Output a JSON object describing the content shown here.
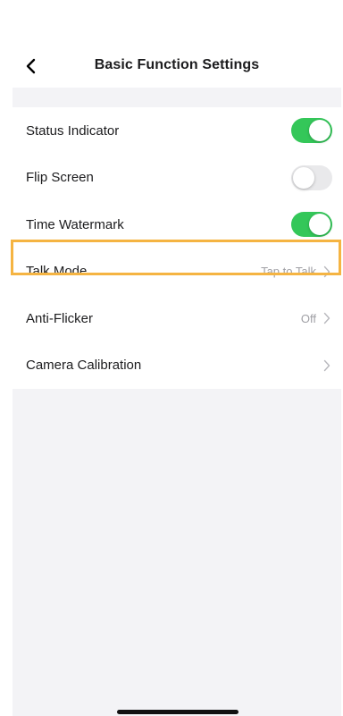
{
  "header": {
    "title": "Basic Function Settings",
    "back_icon": "chevron-left-icon"
  },
  "settings": [
    {
      "label": "Status Indicator",
      "type": "toggle",
      "on": true
    },
    {
      "label": "Flip Screen",
      "type": "toggle",
      "on": false
    },
    {
      "label": "Time Watermark",
      "type": "toggle",
      "on": true
    },
    {
      "label": "Talk Mode",
      "type": "nav",
      "value": "Tap to Talk",
      "highlighted": true
    },
    {
      "label": "Anti-Flicker",
      "type": "nav",
      "value": "Off"
    },
    {
      "label": "Camera Calibration",
      "type": "nav",
      "value": ""
    }
  ],
  "colors": {
    "toggle_on": "#34c759",
    "toggle_off": "#e9e9eb",
    "highlight_border": "#f5b442",
    "background": "#f3f3f6",
    "secondary_text": "#a0a0a5"
  }
}
